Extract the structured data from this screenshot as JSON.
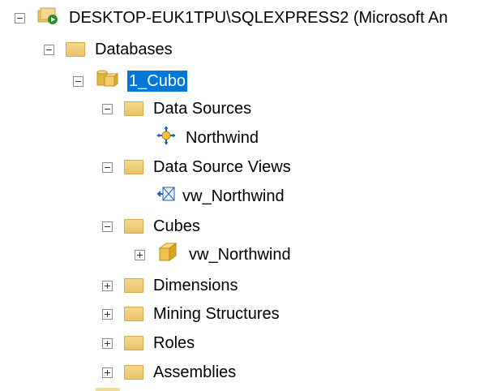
{
  "tree": {
    "server": {
      "label": "DESKTOP-EUK1TPU\\SQLEXPRESS2 (Microsoft An",
      "icon": "analysis-server-icon",
      "expanded": true
    },
    "databases": {
      "label": "Databases",
      "icon": "folder-icon",
      "expanded": true
    },
    "cubo": {
      "label": "1_Cubo",
      "icon": "database-icon",
      "selected": true,
      "expanded": true
    },
    "data_sources": {
      "label": "Data Sources",
      "icon": "folder-icon",
      "expanded": true
    },
    "northwind": {
      "label": "Northwind",
      "icon": "data-source-icon"
    },
    "data_source_views": {
      "label": "Data Source Views",
      "icon": "folder-icon",
      "expanded": true
    },
    "vw_northwind_dsv": {
      "label": "vw_Northwind",
      "icon": "data-source-view-icon"
    },
    "cubes": {
      "label": "Cubes",
      "icon": "folder-icon",
      "expanded": true
    },
    "vw_northwind_cube": {
      "label": "vw_Northwind",
      "icon": "cube-icon",
      "expanded": false
    },
    "dimensions": {
      "label": "Dimensions",
      "icon": "folder-icon",
      "expanded": false
    },
    "mining_structures": {
      "label": "Mining Structures",
      "icon": "folder-icon",
      "expanded": false
    },
    "roles": {
      "label": "Roles",
      "icon": "folder-icon",
      "expanded": false
    },
    "assemblies": {
      "label": "Assemblies",
      "icon": "folder-icon",
      "expanded": false
    }
  },
  "colors": {
    "selection": "#0078d7",
    "folder": "#e9c46a",
    "server_accent": "#2a8f2a",
    "cube": "#e9b93a"
  }
}
